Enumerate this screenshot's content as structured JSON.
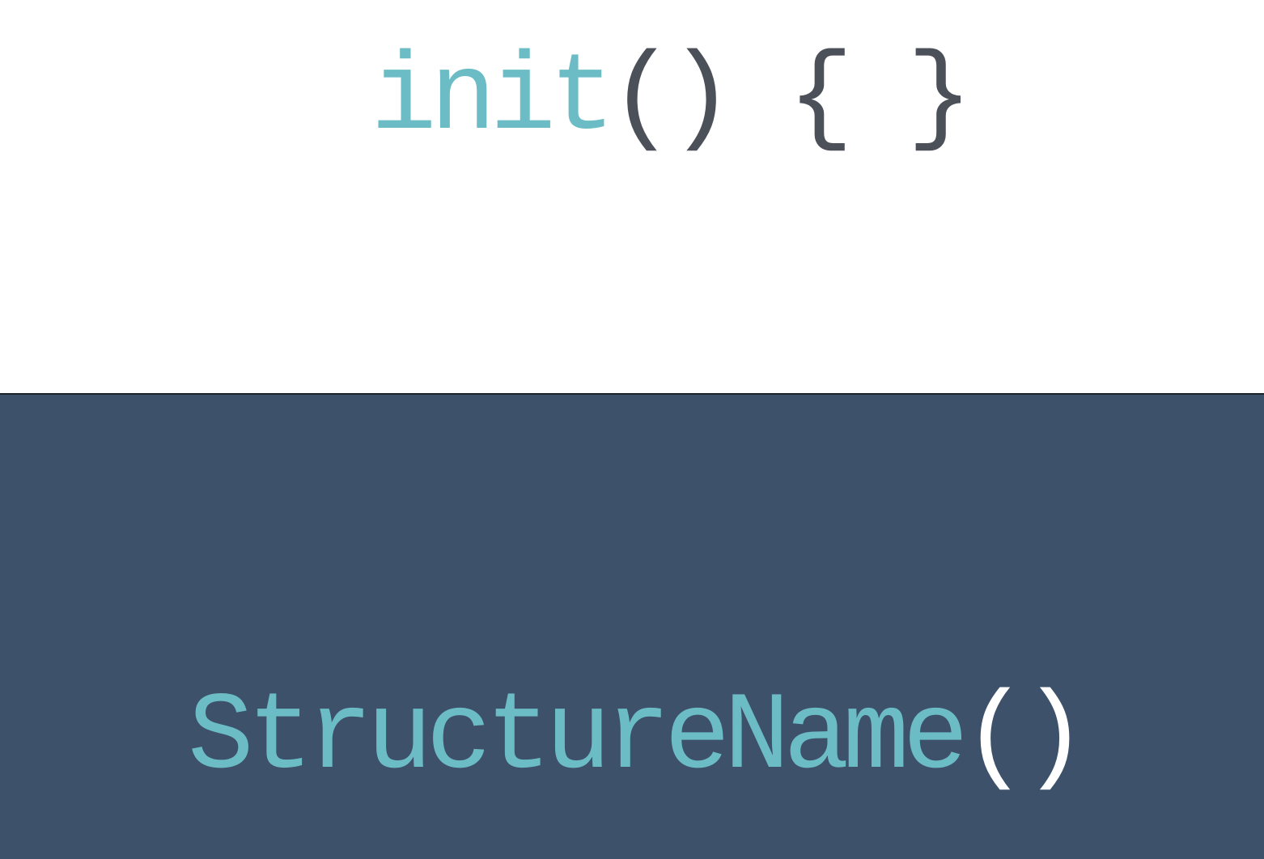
{
  "top_code": {
    "keyword": "init",
    "parens": "()",
    "spacer": " ",
    "braces": "{ }"
  },
  "bottom_code": {
    "name": "StructureName",
    "parens": "()"
  },
  "colors": {
    "top_background": "#ffffff",
    "bottom_background": "#3d516b",
    "keyword": "#6cbcc6",
    "dark_punctuation": "#4b5059",
    "light_punctuation": "#ffffff"
  }
}
